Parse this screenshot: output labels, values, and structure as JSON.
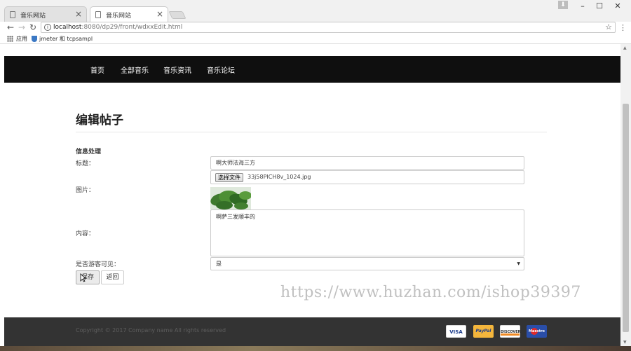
{
  "browser": {
    "tabs": [
      {
        "title": "音乐网站"
      },
      {
        "title": "音乐网站"
      }
    ],
    "url_host": "localhost",
    "url_path": ":8080/dp29/front/wdxxEdit.html",
    "bookmarks": [
      {
        "label": "应用"
      },
      {
        "label": "jmeter 和 tcpsampl"
      }
    ]
  },
  "nav": {
    "items": [
      {
        "label": "首页"
      },
      {
        "label": "全部音乐"
      },
      {
        "label": "音乐资讯"
      },
      {
        "label": "音乐论坛"
      }
    ]
  },
  "page": {
    "heading": "编辑帖子",
    "section": "信息处理"
  },
  "form": {
    "title_label": "标题：",
    "title_value": "啊大师法海三方",
    "image_label": "图片：",
    "choose_file_label": "选择文件",
    "file_name": "33j58PICH8v_1024.jpg",
    "content_label": "内容：",
    "content_value": "啊萨三发顺丰的",
    "visible_label": "是否游客可见：",
    "visible_value": "是",
    "save_label": "保存",
    "back_label": "返回"
  },
  "watermark": "https://www.huzhan.com/ishop39397",
  "footer": {
    "copyright": "Copyright © 2017 Company name All rights reserved",
    "cards": [
      "VISA",
      "PayPal",
      "DISCOVER",
      "Maestro"
    ]
  },
  "colors": {
    "navbar": "#0f0f0f",
    "footer": "#333333"
  }
}
